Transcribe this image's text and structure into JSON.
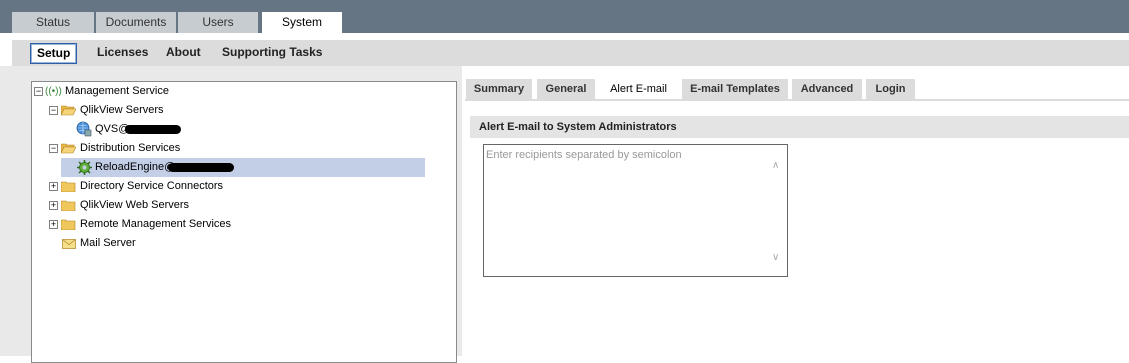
{
  "top_tabs": [
    {
      "label": "Status"
    },
    {
      "label": "Documents"
    },
    {
      "label": "Users"
    },
    {
      "label": "System",
      "active": true
    }
  ],
  "sub_tabs": [
    {
      "label": "Setup",
      "active": true
    },
    {
      "label": "Licenses"
    },
    {
      "label": "About"
    },
    {
      "label": "Supporting Tasks"
    }
  ],
  "tree": {
    "root": {
      "label": "Management Service",
      "icon": "broadcast-icon"
    },
    "items": [
      {
        "label": "QlikView Servers",
        "icon": "folder-open-icon"
      },
      {
        "label": "QVS@",
        "icon": "globe-server-icon"
      },
      {
        "label": "Distribution Services",
        "icon": "folder-open-icon"
      },
      {
        "label": "ReloadEngine@",
        "icon": "gear-icon",
        "selected": true
      },
      {
        "label": "Directory Service Connectors",
        "icon": "folder-icon"
      },
      {
        "label": "QlikView Web Servers",
        "icon": "folder-icon"
      },
      {
        "label": "Remote Management Services",
        "icon": "folder-icon"
      },
      {
        "label": "Mail Server",
        "icon": "envelope-icon"
      }
    ]
  },
  "right_tabs": [
    {
      "label": "Summary"
    },
    {
      "label": "General"
    },
    {
      "label": "Alert E-mail",
      "active": true
    },
    {
      "label": "E-mail Templates"
    },
    {
      "label": "Advanced"
    },
    {
      "label": "Login"
    }
  ],
  "alert": {
    "section_title": "Alert E-mail to System Administrators",
    "recipients_placeholder": "Enter recipients separated by semicolon",
    "recipients_value": ""
  },
  "colors": {
    "topbar": "#667584",
    "selection": "#c3cfe6",
    "active_border": "#2b5fa8"
  }
}
